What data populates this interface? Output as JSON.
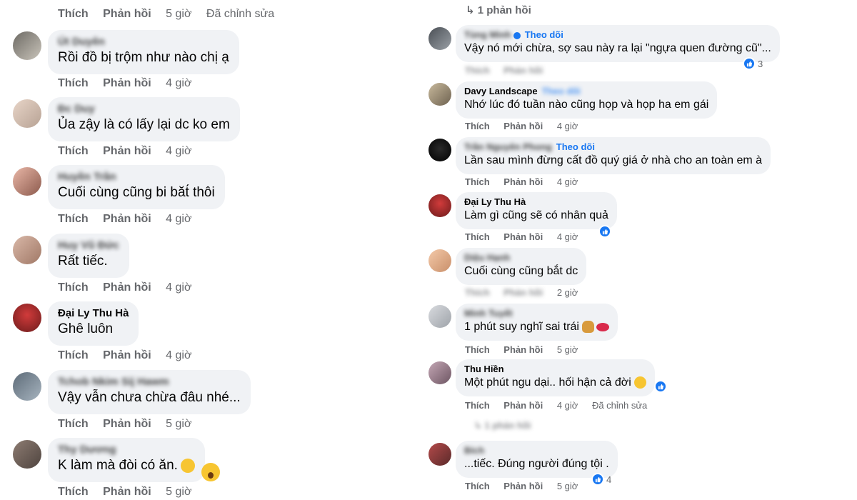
{
  "labels": {
    "like": "Thích",
    "reply": "Phản hồi"
  },
  "colors": {
    "bubble": "#f0f2f5",
    "link": "#1877f2",
    "muted": "#65676b",
    "reaction": "#1877f2"
  },
  "left": {
    "top_actions": {
      "time": "5 giờ",
      "edited": "Đã chỉnh sửa"
    },
    "comments": [
      {
        "name": "Út Duyên",
        "text": "Rồi đồ bị trộm như nào chị ạ",
        "time": "4 giờ"
      },
      {
        "name": "Đc Duy",
        "text": "Ủa zậy là có lấy lại dc ko em",
        "time": "4 giờ"
      },
      {
        "name": "Huyền Trần",
        "text": "Cuối cùng cũng bi băt́ thôi",
        "time": "4 giờ"
      },
      {
        "name": "Huy Vũ Đức",
        "text": "Rất tiếc.",
        "time": "4 giờ"
      },
      {
        "name": "Đại Ly Thu Hà",
        "text": "Ghê luôn",
        "time": "4 giờ"
      },
      {
        "name": "Tchob Nkim Sij Hawm",
        "text": "Vậy vẫn chưa chừa đâu nhé...",
        "time": "5 giờ"
      },
      {
        "name": "Thy Dương",
        "text": "K làm mà đòi có ăn.",
        "time": "5 giờ",
        "emojis": [
          "sweat-smile-emoji-icon",
          "astonished-emoji-icon"
        ]
      }
    ]
  },
  "right": {
    "replies_link": "1 phản hồi",
    "follow_label": "Theo dõi",
    "comments": [
      {
        "name": "Tùng Minh",
        "follow": true,
        "verified": true,
        "text": "Vậy nó mới chừa, sợ sau này ra lại \"ngựa quen đường cũ\"...",
        "time": "",
        "reaction_count": "3"
      },
      {
        "name": "Davy Landscape",
        "follow": true,
        "text": "Nhớ lúc đó tuần nào cũng họp và họp ha em gái",
        "time": "4 giờ"
      },
      {
        "name": "Trần Nguyên Phong",
        "follow": true,
        "text": "Lần sau mình đừng cất đồ quý giá ở nhà cho an toàn em à",
        "time": "4 giờ"
      },
      {
        "name": "Đại Ly Thu Hà",
        "text": "Làm gì cũng sẽ có nhân quả",
        "time": "4 giờ",
        "reaction_count": ""
      },
      {
        "name": "Diệu Hạnh",
        "text": "Cuối cùng cũng bắt dc",
        "time": "2 giờ"
      },
      {
        "name": "Minh Tuyết",
        "text": "1 phút suy nghĩ sai trái",
        "time": "5 giờ",
        "emojis": [
          "prayer-emoji-icon",
          "lips-emoji-icon"
        ]
      },
      {
        "name": "Thu Hiền",
        "text": "Một phút ngu dại.. hối hận cả đời",
        "time": "4 giờ",
        "edited": "Đã chỉnh sửa",
        "emojis": [
          "pensive-emoji-icon"
        ],
        "reaction_count": ""
      },
      {
        "name": "Bích",
        "text": "...tiếc. Đúng người đúng tội .",
        "time": "5 giờ",
        "reaction_count": "4",
        "previous": "1 phản hồi"
      }
    ]
  }
}
